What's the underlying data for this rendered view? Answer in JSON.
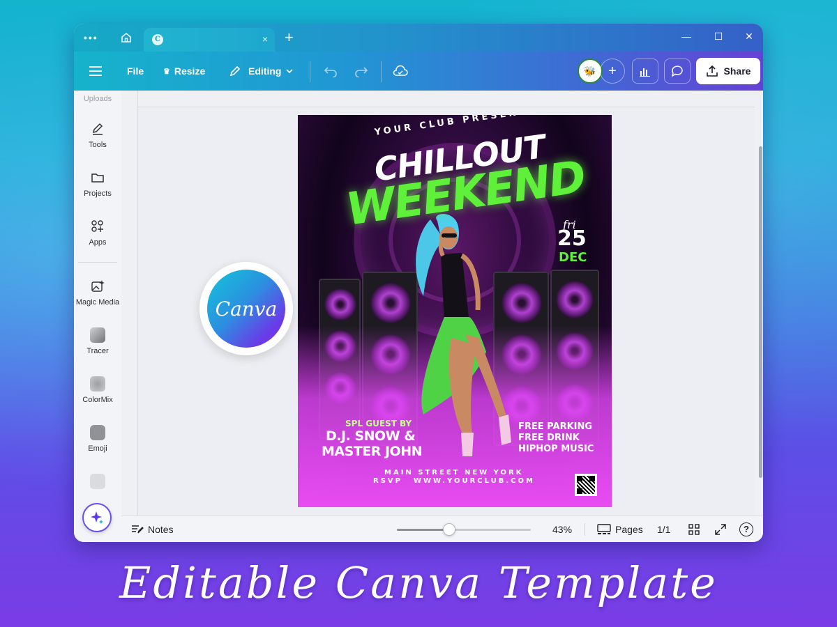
{
  "window": {
    "tab_logo": "C",
    "tab_close": "×",
    "new_tab": "+"
  },
  "toolbar": {
    "file": "File",
    "resize": "Resize",
    "editing": "Editing",
    "share": "Share",
    "avatar_emoji": "🐝",
    "add": "+"
  },
  "sidebar": {
    "uploads": "Uploads",
    "tools": "Tools",
    "projects": "Projects",
    "apps": "Apps",
    "magic_media": "Magic Media",
    "tracer": "Tracer",
    "colormix": "ColorMix",
    "emoji": "Emoji"
  },
  "poster": {
    "presents": "YOUR CLUB PRESENTS",
    "title1": "CHILLOUT",
    "title2": "WEEKEND",
    "day_script": "fri",
    "date": "25",
    "month": "DEC",
    "guest_label": "SPL GUEST BY",
    "guest1": "D.J. SNOW &",
    "guest2": "MASTER JOHN",
    "perk1": "FREE PARKING",
    "perk2": "FREE DRINK",
    "perk3": "HIPHOP MUSIC",
    "address": "MAIN STREET NEW YORK",
    "rsvp": "RSVP",
    "website": "WWW.YOURCLUB.COM"
  },
  "badge": {
    "text": "Canva"
  },
  "statusbar": {
    "notes": "Notes",
    "zoom": "43%",
    "zoom_fraction": 0.39,
    "pages": "Pages",
    "page_count": "1/1",
    "help": "?"
  },
  "caption": "Editable Canva Template",
  "colors": {
    "accent_purple": "#7b2ff0",
    "accent_teal": "#14c6d9",
    "poster_green": "#5ff03a",
    "poster_magenta": "#e84cf2"
  }
}
